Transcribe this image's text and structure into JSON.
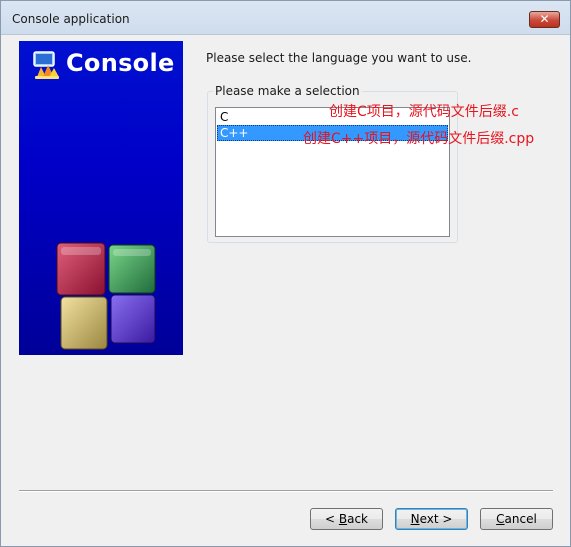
{
  "window": {
    "title": "Console application",
    "close_symbol": "✕"
  },
  "banner": {
    "title": "Console",
    "logo_icon": "codeblocks-logo-icon",
    "art_icon": "colored-cubes-icon"
  },
  "main": {
    "instruction": "Please select the language you want to use.",
    "group_label": "Please make a selection",
    "options": [
      {
        "label": "C",
        "selected": false
      },
      {
        "label": "C++",
        "selected": true
      }
    ],
    "annotations": [
      "创建C项目，源代码文件后缀.c",
      "创建C++项目，源代码文件后缀.cpp"
    ]
  },
  "buttons": {
    "back": {
      "prefix": "< ",
      "mnemonic": "B",
      "rest": "ack"
    },
    "next": {
      "mnemonic": "N",
      "rest": "ext >"
    },
    "cancel": {
      "mnemonic": "C",
      "rest": "ancel"
    }
  },
  "colors": {
    "banner_blue": "#0000c8",
    "selection": "#3399ff",
    "annotation": "#e8141e"
  }
}
